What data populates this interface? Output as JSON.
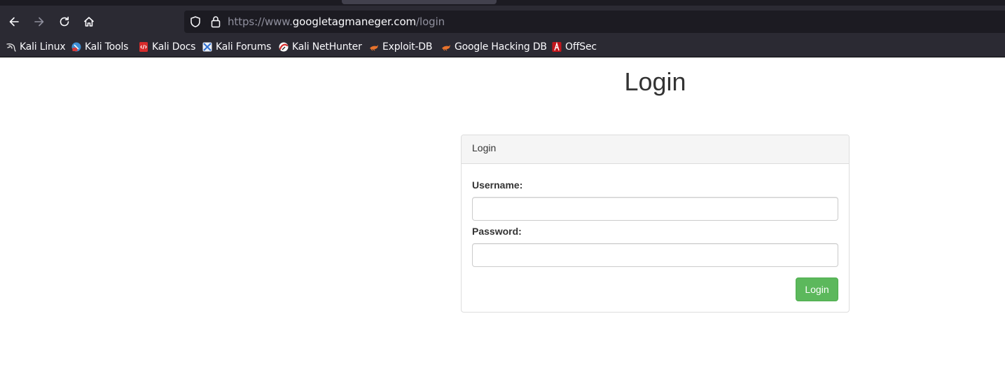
{
  "browser": {
    "url": {
      "scheme": "https://www.",
      "host": "googletagmaneger.com",
      "path": "/login"
    },
    "nav_icons": [
      "back-arrow-icon",
      "forward-arrow-icon",
      "reload-icon",
      "home-icon"
    ],
    "bookmarks": [
      {
        "label": "Kali Linux",
        "icon": "kali-dragon-icon"
      },
      {
        "label": "Kali Tools",
        "icon": "kali-tools-icon"
      },
      {
        "label": "Kali Docs",
        "icon": "kali-docs-icon"
      },
      {
        "label": "Kali Forums",
        "icon": "kali-forums-icon"
      },
      {
        "label": "Kali NetHunter",
        "icon": "kali-nethunter-icon"
      },
      {
        "label": "Exploit-DB",
        "icon": "exploit-db-icon"
      },
      {
        "label": "Google Hacking DB",
        "icon": "google-hacking-db-icon"
      },
      {
        "label": "OffSec",
        "icon": "offsec-icon"
      }
    ]
  },
  "page": {
    "title": "Login",
    "panel": {
      "heading": "Login",
      "username_label": "Username:",
      "username_value": "",
      "password_label": "Password:",
      "password_value": "",
      "submit_label": "Login"
    }
  },
  "colors": {
    "chrome_bg": "#2b2a33",
    "urlbar_bg": "#1c1b22",
    "success_button": "#5cb85c",
    "panel_heading_bg": "#f5f5f5",
    "text": "#333333"
  }
}
